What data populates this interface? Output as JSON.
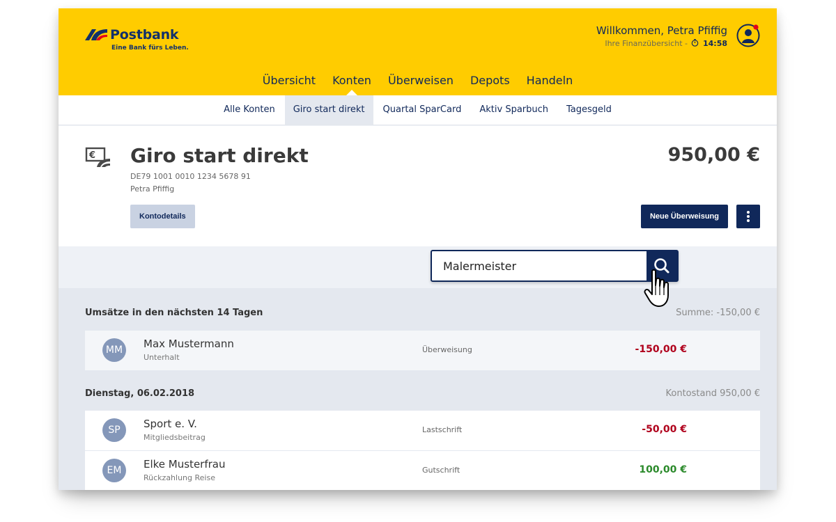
{
  "brand": {
    "name": "Postbank",
    "tagline": "Eine Bank fürs Leben."
  },
  "user": {
    "welcome": "Willkommen, Petra Pfiffig",
    "subtitle": "Ihre Finanzübersicht -",
    "session_time": "14:58"
  },
  "main_nav": [
    "Übersicht",
    "Konten",
    "Überweisen",
    "Depots",
    "Handeln"
  ],
  "sub_nav": [
    "Alle Konten",
    "Giro start direkt",
    "Quartal SparCard",
    "Aktiv Sparbuch",
    "Tagesgeld"
  ],
  "account": {
    "title": "Giro start direkt",
    "iban": "DE79 1001 0010 1234 5678 91",
    "owner": "Petra Pfiffig",
    "balance": "950,00 €",
    "details_label": "Kontodetails",
    "transfer_label": "Neue Überweisung"
  },
  "search": {
    "value": "Malermeister"
  },
  "groups": [
    {
      "title": "Umsätze in den nächsten 14 Tagen",
      "summary": "Summe: -150,00 €",
      "transactions": [
        {
          "initials": "MM",
          "name": "Max Mustermann",
          "purpose": "Unterhalt",
          "type": "Überweisung",
          "amount": "-150,00 €"
        }
      ]
    },
    {
      "title": "Dienstag, 06.02.2018",
      "summary": "Kontostand 950,00 €",
      "transactions": [
        {
          "initials": "SP",
          "name": "Sport e. V.",
          "purpose": "Mitgliedsbeitrag",
          "type": "Lastschrift",
          "amount": "-50,00 €"
        },
        {
          "initials": "EM",
          "name": "Elke Musterfrau",
          "purpose": "Rückzahlung Reise",
          "type": "Gutschrift",
          "amount": "100,00 €"
        }
      ]
    }
  ],
  "colors": {
    "brand_yellow": "#ffcc00",
    "brand_navy": "#10285a",
    "negative": "#b0001c",
    "positive": "#2b8a2b"
  },
  "icons": {
    "account": "banknote-card-icon",
    "search": "search-icon",
    "more": "more-vertical-icon",
    "profile": "user-icon",
    "timer": "clock-icon"
  }
}
